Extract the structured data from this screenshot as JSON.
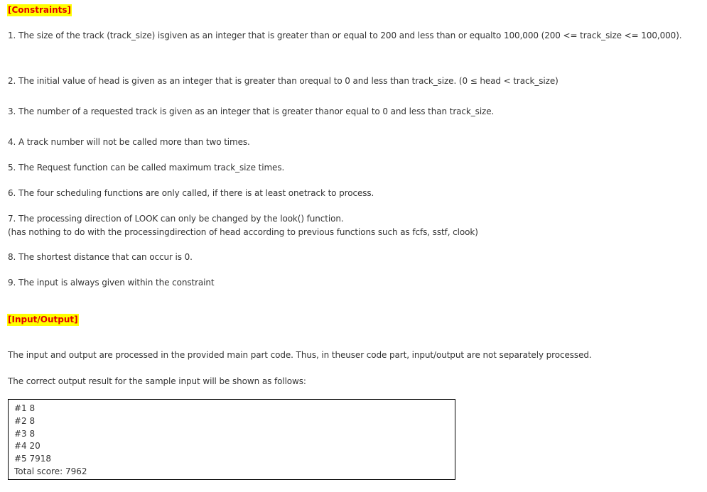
{
  "constraints": {
    "heading": "[Constraints]",
    "items": [
      "1. The size of the track (track_size) isgiven as an integer that is greater than or equal to 200 and less than or equalto 100,000 (200 <= track_size <= 100,000).",
      "2. The initial value of head is given as an integer that is greater than orequal to 0 and less than track_size. (0 ≤ head < track_size)",
      "3. The number of a requested track is given as an integer that is greater thanor equal to 0 and less than track_size.",
      "4. A track number will not be called more than two times.",
      "5. The Request function can be called maximum track_size times.",
      "6. The four scheduling functions are only called, if there is at least onetrack to process.",
      "7. The processing direction of LOOK can only be changed by the look() function.",
      "(has nothing to do with the processingdirection of head according to previous functions such as fcfs, sstf, clook)",
      "8. The shortest distance that can occur is 0.",
      "9. The input is always given within the constraint"
    ]
  },
  "io": {
    "heading": "[Input/Output]",
    "para1": "The input and output are processed in the provided main part code. Thus, in theuser code part, input/output are not separately processed.",
    "para2": "The correct output result for the sample input will be shown as follows:",
    "output_lines": [
      "#1 8",
      "#2 8",
      "#3 8",
      "#4 20",
      "#5 7918",
      "Total score: 7962"
    ]
  }
}
